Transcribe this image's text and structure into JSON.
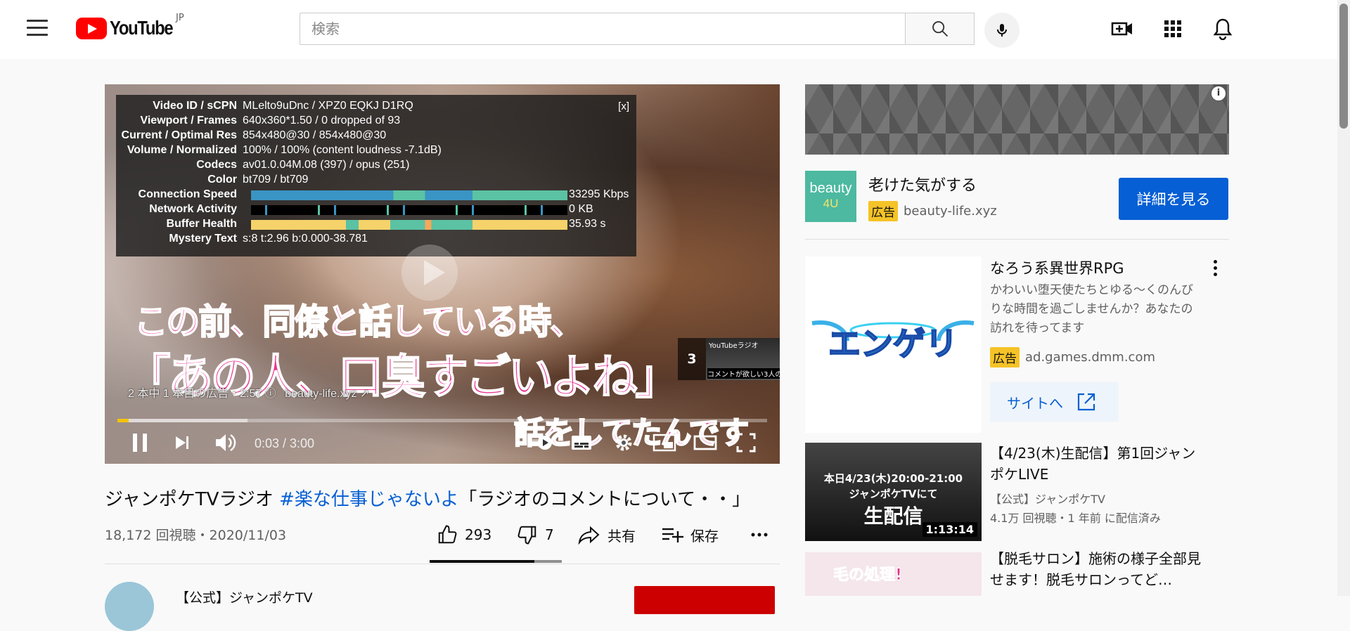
{
  "header": {
    "logo_text": "YouTube",
    "region": "JP",
    "search_placeholder": "検索",
    "icons": [
      "menu-icon",
      "search-icon",
      "mic-icon",
      "create-icon",
      "apps-icon",
      "bell-icon"
    ]
  },
  "player": {
    "stats": {
      "rows": [
        {
          "label": "Video ID / sCPN",
          "value": "MLelto9uDnc / XPZ0 EQKJ D1RQ"
        },
        {
          "label": "Viewport / Frames",
          "value": "640x360*1.50 / 0 dropped of 93"
        },
        {
          "label": "Current / Optimal Res",
          "value": "854x480@30 / 854x480@30"
        },
        {
          "label": "Volume / Normalized",
          "value": "100% / 100% (content loudness -7.1dB)"
        },
        {
          "label": "Codecs",
          "value": "av01.0.04M.08 (397) / opus (251)"
        },
        {
          "label": "Color",
          "value": "bt709 / bt709"
        },
        {
          "label": "Connection Speed",
          "value": "33295 Kbps"
        },
        {
          "label": "Network Activity",
          "value": "0 KB"
        },
        {
          "label": "Buffer Health",
          "value": "35.93 s"
        },
        {
          "label": "Mystery Text",
          "value": "s:8 t:2.96 b:0.000-38.781"
        }
      ],
      "close_label": "[x]"
    },
    "captions": {
      "line1": "この前、同僚と話している時、",
      "line2": "「あの人、口臭すごいよね」",
      "line3": "話をしてたんです"
    },
    "ad_info": {
      "text": "2 本中 1 本目の広告・2:57",
      "domain": "beauty-life.xyz"
    },
    "endcard": {
      "count": "3",
      "thumb_top": "YouTubeラジオ",
      "thumb_bottom": "コメントが欲しい3人の話"
    },
    "time": "0:03 / 3:00",
    "progress": {
      "played": 0.017,
      "buffered": 0.2
    },
    "accent_color": "#f5c400"
  },
  "video": {
    "title_prefix": "ジャンポケTVラジオ ",
    "title_tag": "#楽な仕事じゃないよ",
    "title_suffix": "「ラジオのコメントについて・・」",
    "meta": "18,172 回視聴・2020/11/03",
    "likes": "293",
    "dislikes": "7",
    "share_label": "共有",
    "save_label": "保存",
    "channel_name": "【公式】ジャンポケTV"
  },
  "sidebar": {
    "ad1": {
      "logo_line1": "beauty",
      "logo_line2": "4U",
      "title": "老けた気がする",
      "badge": "広告",
      "domain": "beauty-life.xyz",
      "button": "詳細を見る"
    },
    "ad2": {
      "title": "なろう系異世界RPG",
      "description": "かわいい堕天使たちとゆる～くのんびりな時間を過ごしませんか？あなたの訪れを待ってます",
      "badge": "広告",
      "domain": "ad.games.dmm.com",
      "site_button": "サイトへ",
      "logo_text": "エンゲリ"
    },
    "videos": [
      {
        "title": "【4/23(木)生配信】第1回ジャンポケLIVE",
        "channel": "【公式】ジャンポケTV",
        "meta": "4.1万 回視聴・1 年前 に配信済み",
        "duration": "1:13:14",
        "thumb_line1": "本日4/23(木)20:00-21:00",
        "thumb_line2": "ジャンポケTVにて",
        "thumb_line3": "生配信"
      },
      {
        "title": "【脱毛サロン】施術の様子全部見せます！脱毛サロンってど…",
        "thumb_text": "毛の処理!"
      }
    ]
  }
}
